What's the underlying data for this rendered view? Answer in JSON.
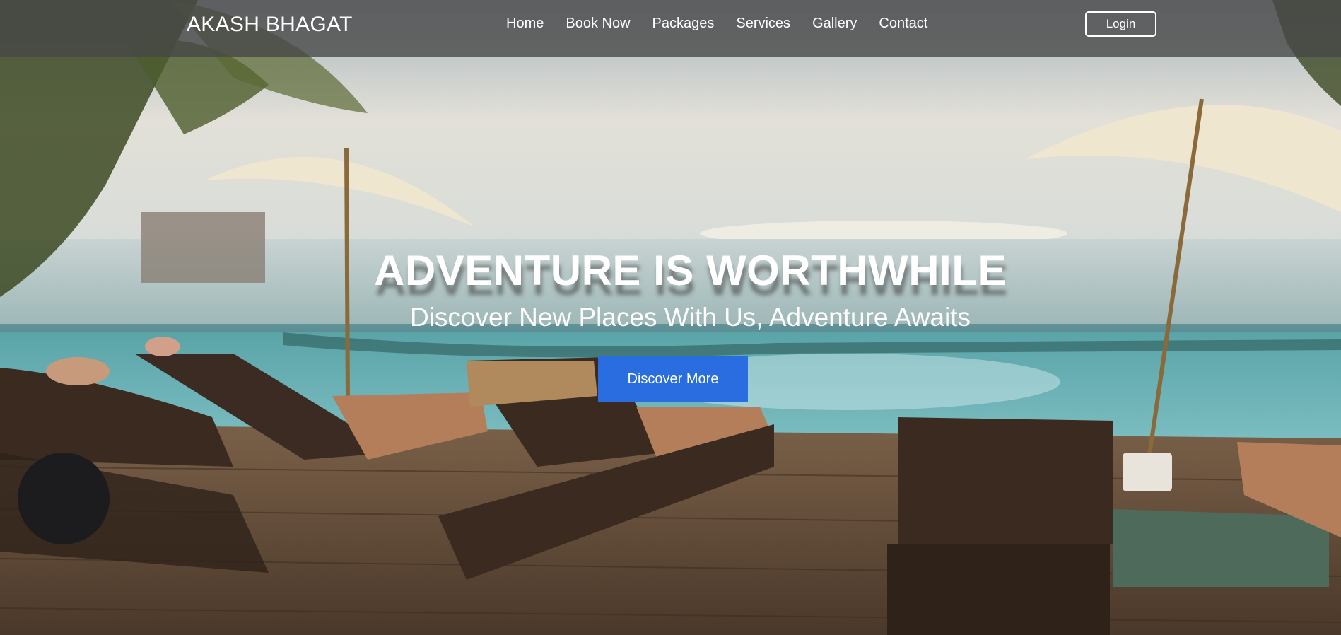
{
  "brand": {
    "name": "AKASH BHAGAT"
  },
  "nav": {
    "links": [
      {
        "label": "Home"
      },
      {
        "label": "Book Now"
      },
      {
        "label": "Packages"
      },
      {
        "label": "Services"
      },
      {
        "label": "Gallery"
      },
      {
        "label": "Contact"
      }
    ],
    "login_label": "Login"
  },
  "hero": {
    "title": "ADVENTURE IS WORTHWHILE",
    "subtitle": "Discover New Places With Us, Adventure Awaits",
    "cta_label": "Discover More"
  },
  "colors": {
    "accent": "#2a6de0",
    "navbar_bg": "#464646"
  }
}
